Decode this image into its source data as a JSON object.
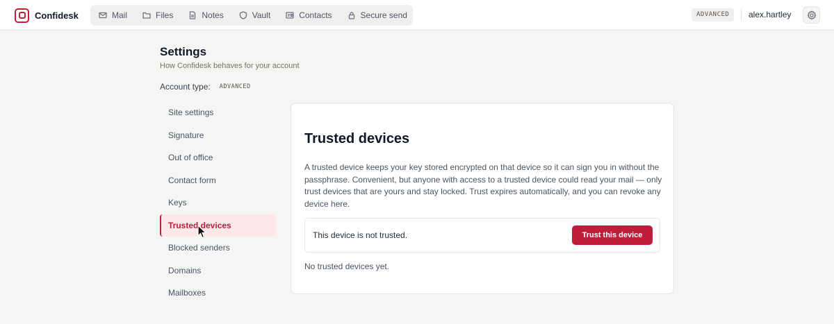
{
  "app": {
    "name": "Confidesk"
  },
  "nav": {
    "items": [
      {
        "label": "Mail",
        "icon": "mail-icon"
      },
      {
        "label": "Files",
        "icon": "folder-icon"
      },
      {
        "label": "Notes",
        "icon": "note-icon"
      },
      {
        "label": "Vault",
        "icon": "shield-icon"
      },
      {
        "label": "Contacts",
        "icon": "contact-card-icon"
      },
      {
        "label": "Secure send",
        "icon": "lock-icon"
      }
    ]
  },
  "header": {
    "account_badge": "ADVANCED",
    "username": "alex.hartley",
    "settings_icon": "gear-icon"
  },
  "settings": {
    "title": "Settings",
    "subtitle": "How Confidesk behaves for your account",
    "account_type_label": "Account type:",
    "account_type_value": "ADVANCED",
    "menu": [
      {
        "label": "Site settings",
        "active": false
      },
      {
        "label": "Signature",
        "active": false
      },
      {
        "label": "Out of office",
        "active": false
      },
      {
        "label": "Contact form",
        "active": false
      },
      {
        "label": "Keys",
        "active": false
      },
      {
        "label": "Trusted devices",
        "active": true
      },
      {
        "label": "Blocked senders",
        "active": false
      },
      {
        "label": "Domains",
        "active": false
      },
      {
        "label": "Mailboxes",
        "active": false
      }
    ]
  },
  "panel": {
    "title": "Trusted devices",
    "description": "A trusted device keeps your key stored encrypted on that device so it can sign you in without the passphrase. Convenient, but anyone with access to a trusted device could read your mail — only trust devices that are yours and stay locked. Trust expires automatically, and you can revoke any device here.",
    "status_text": "This device is not trusted.",
    "trust_button_label": "Trust this device",
    "empty_state": "No trusted devices yet."
  },
  "colors": {
    "accent": "#be1e3a",
    "active_bg": "#fce7e9",
    "page_bg": "#f5f5f4"
  }
}
